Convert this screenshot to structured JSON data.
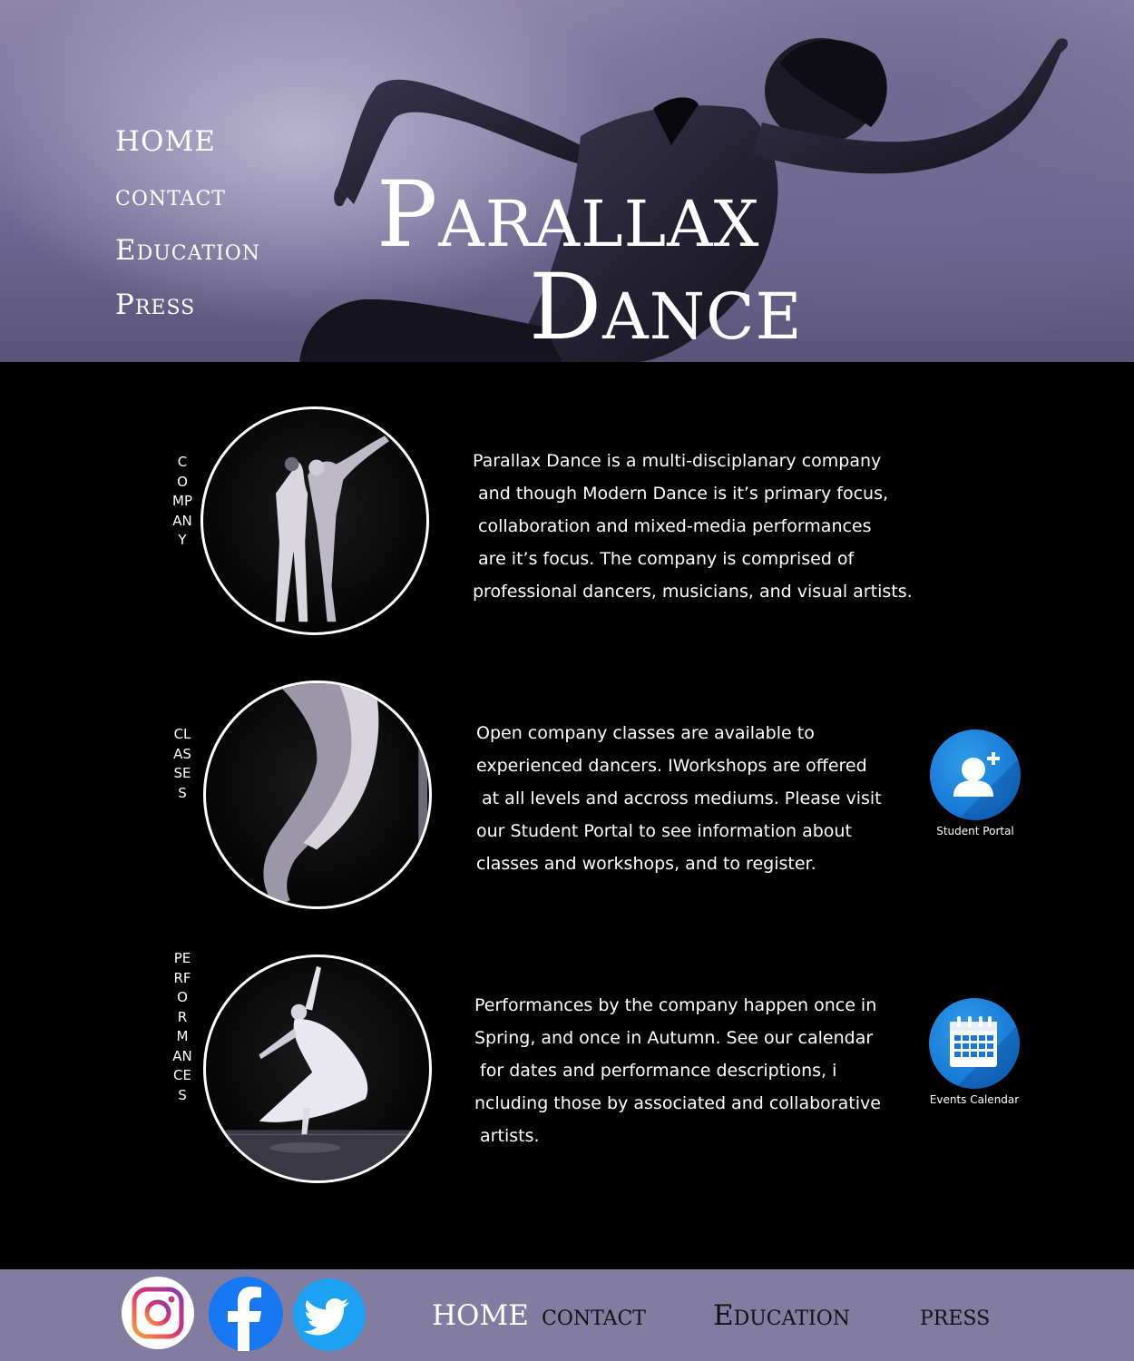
{
  "site": {
    "brand_line1": "Parallax",
    "brand_line2": "Dance"
  },
  "nav": [
    {
      "label": "HOME"
    },
    {
      "label": "contact"
    },
    {
      "label": "Education"
    },
    {
      "label": "Press"
    }
  ],
  "sections": [
    {
      "id": "company",
      "label": "COMPANY",
      "text": "Parallax Dance is a multi-disciplanary company\n and though Modern Dance is it’s primary focus,\n collaboration and mixed-media performances\n are it’s focus. The company is comprised of\nprofessional dancers, musicians, and visual artists."
    },
    {
      "id": "classes",
      "label": "CLASSES",
      "text": "Open company classes are available to\nexperienced dancers. IWorkshops are offered\n at all levels and accross mediums. Please visit\nour Student Portal to see information about\nclasses and workshops, and to register.",
      "action": {
        "label": "Student Portal",
        "icon": "add-user-icon"
      }
    },
    {
      "id": "performances",
      "label": "PERFORMANCES",
      "text": "Performances by the company happen once in\nSpring, and once in Autumn. See our calendar\n for dates and performance descriptions, i\nncluding those by associated and collaborative\n artists.",
      "action": {
        "label": "Events Calendar",
        "icon": "calendar-icon"
      }
    }
  ],
  "footer": {
    "social": [
      "instagram-icon",
      "facebook-icon",
      "twitter-icon"
    ],
    "nav": [
      {
        "label": "HOME",
        "color": "#ffffff"
      },
      {
        "label": "contact",
        "color": "#111111"
      },
      {
        "label": "Education",
        "color": "#111111"
      },
      {
        "label": "press",
        "color": "#111111"
      }
    ]
  },
  "colors": {
    "hero_tint": "#8e87aa",
    "footer_bg": "#827da0",
    "action_blue": "#1677d6",
    "page_bg": "#000000"
  }
}
